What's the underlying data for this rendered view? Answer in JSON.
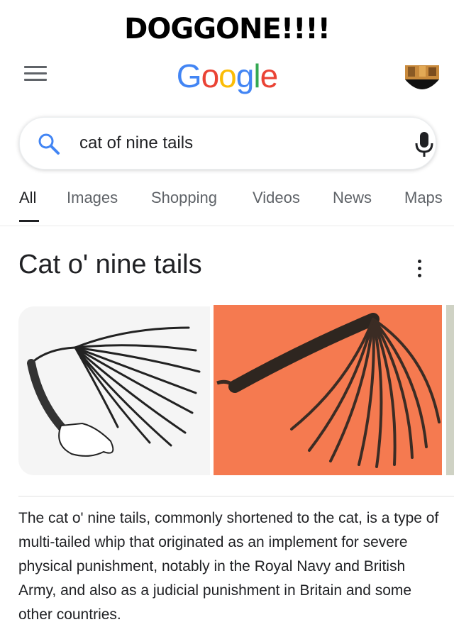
{
  "meme": {
    "caption": "DOGGONE!!!!"
  },
  "header": {
    "logo_letters": [
      {
        "char": "G",
        "color": "#4285F4"
      },
      {
        "char": "o",
        "color": "#EA4335"
      },
      {
        "char": "o",
        "color": "#FBBC05"
      },
      {
        "char": "g",
        "color": "#4285F4"
      },
      {
        "char": "l",
        "color": "#34A853"
      },
      {
        "char": "e",
        "color": "#EA4335"
      }
    ],
    "menu_icon": "hamburger-icon",
    "avatar_icon": "profile-avatar"
  },
  "search": {
    "query": "cat of nine tails",
    "search_icon": "search-icon",
    "mic_icon": "mic-icon",
    "accent_color": "#4285F4"
  },
  "tabs": [
    {
      "label": "All",
      "active": true
    },
    {
      "label": "Images",
      "active": false
    },
    {
      "label": "Shopping",
      "active": false
    },
    {
      "label": "Videos",
      "active": false
    },
    {
      "label": "News",
      "active": false
    },
    {
      "label": "Maps",
      "active": false
    }
  ],
  "knowledge_panel": {
    "title": "Cat o' nine tails",
    "more_icon": "more-vert-icon",
    "description": "The cat o' nine tails, commonly shortened to the cat, is a type of multi-tailed whip that originated as an implement for severe physical punishment, notably in the Royal Navy and British Army, and also as a judicial punishment in Britain and some other countries."
  }
}
